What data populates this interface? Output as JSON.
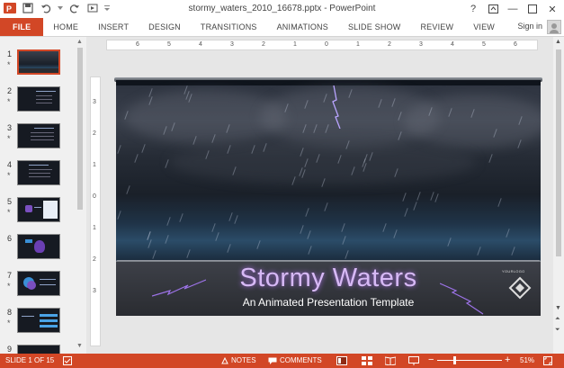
{
  "app": {
    "window_title": "stormy_waters_2010_16678.pptx - PowerPoint",
    "accent": "#d24726"
  },
  "window_controls": {
    "help": "?",
    "minimize": "—",
    "close": "✕"
  },
  "ribbon": {
    "tabs": [
      "FILE",
      "HOME",
      "INSERT",
      "DESIGN",
      "TRANSITIONS",
      "ANIMATIONS",
      "SLIDE SHOW",
      "REVIEW",
      "VIEW"
    ],
    "sign_in": "Sign in"
  },
  "thumbnails": [
    {
      "num": "1",
      "star": "*"
    },
    {
      "num": "2",
      "star": "*"
    },
    {
      "num": "3",
      "star": "*"
    },
    {
      "num": "4",
      "star": "*"
    },
    {
      "num": "5",
      "star": "*"
    },
    {
      "num": "6",
      "star": ""
    },
    {
      "num": "7",
      "star": "*"
    },
    {
      "num": "8",
      "star": "*"
    },
    {
      "num": "9",
      "star": ""
    }
  ],
  "ruler": {
    "horizontal": [
      "6",
      "5",
      "4",
      "3",
      "2",
      "1",
      "0",
      "1",
      "2",
      "3",
      "4",
      "5",
      "6"
    ],
    "vertical": [
      "3",
      "2",
      "1",
      "0",
      "1",
      "2",
      "3"
    ]
  },
  "slide": {
    "title": "Stormy Waters",
    "subtitle": "An Animated Presentation Template",
    "logo_text": "YOURLOGO"
  },
  "status": {
    "slide_info": "SLIDE 1 OF 15",
    "notes": "NOTES",
    "comments": "COMMENTS",
    "zoom": "51%"
  }
}
